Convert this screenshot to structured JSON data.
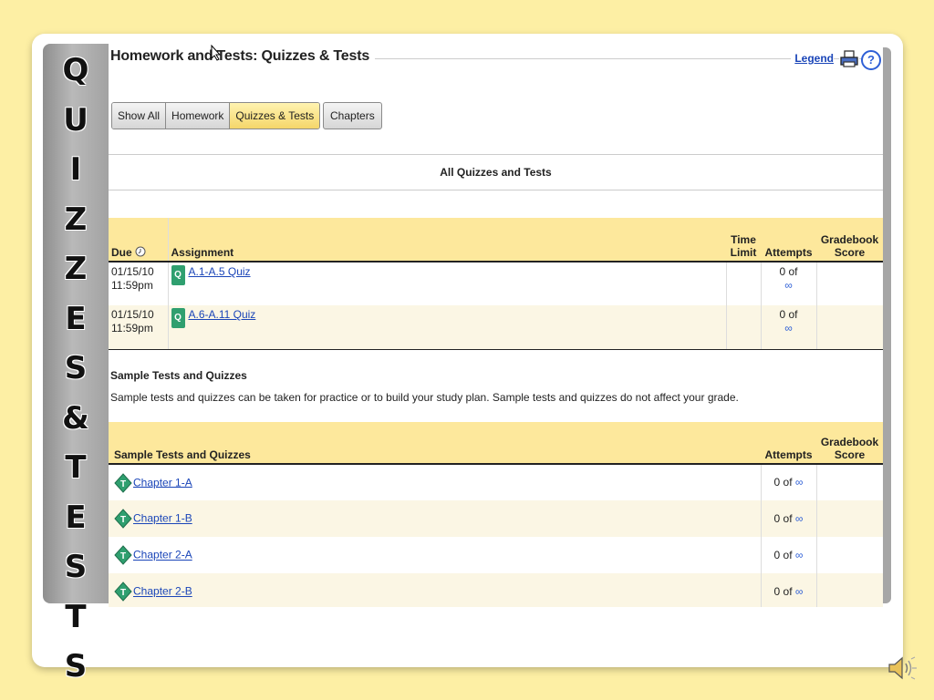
{
  "vertical_title": [
    "Q",
    "U",
    "I",
    "Z",
    "Z",
    "E",
    "S",
    "&",
    "T",
    "E",
    "S",
    "T",
    "S"
  ],
  "header": {
    "title": "Homework and Tests: Quizzes & Tests",
    "legend_link": "Legend",
    "help_glyph": "?"
  },
  "tabs": [
    {
      "label": "Show All",
      "active": false
    },
    {
      "label": "Homework",
      "active": false
    },
    {
      "label": "Quizzes & Tests",
      "active": true
    }
  ],
  "chapters_button": "Chapters",
  "section_heading": "All Quizzes and Tests",
  "assignments_table": {
    "headers": {
      "due": "Due",
      "assignment": "Assignment",
      "time_limit_1": "Time",
      "time_limit_2": "Limit",
      "attempts": "Attempts",
      "gradebook_1": "Gradebook",
      "gradebook_2": "Score"
    },
    "rows": [
      {
        "date": "01/15/10",
        "time": "11:59pm",
        "badge": "Q",
        "name": "A.1-A.5 Quiz",
        "attempts": "0 of",
        "attempts_max": "∞"
      },
      {
        "date": "01/15/10",
        "time": "11:59pm",
        "badge": "Q",
        "name": "A.6-A.11 Quiz",
        "attempts": "0 of",
        "attempts_max": "∞"
      }
    ]
  },
  "sample_section": {
    "title": "Sample Tests and Quizzes",
    "description": "Sample tests and quizzes can be taken for practice or to build your study plan. Sample tests and quizzes do not affect your grade."
  },
  "sample_table": {
    "headers": {
      "name": "Sample Tests and Quizzes",
      "attempts": "Attempts",
      "gradebook_1": "Gradebook",
      "gradebook_2": "Score"
    },
    "rows": [
      {
        "name": "Chapter 1-A",
        "attempts": "0 of",
        "attempts_max": "∞"
      },
      {
        "name": "Chapter 1-B",
        "attempts": "0 of",
        "attempts_max": "∞"
      },
      {
        "name": "Chapter 2-A",
        "attempts": "0 of",
        "attempts_max": "∞"
      },
      {
        "name": "Chapter 2-B",
        "attempts": "0 of",
        "attempts_max": "∞"
      }
    ]
  },
  "icons": {
    "help": "help-icon",
    "print": "print-icon",
    "quiz_badge": "quiz-badge-icon",
    "sample_test": "sample-test-diamond-icon",
    "sound": "speaker-icon",
    "due_info": "clock-info-icon"
  },
  "colors": {
    "slide_background": "#fdefa4",
    "table_header": "#fde89c",
    "active_tab": "#f5d66a",
    "link": "#1a45b8",
    "quiz_badge": "#2f9f6f"
  }
}
